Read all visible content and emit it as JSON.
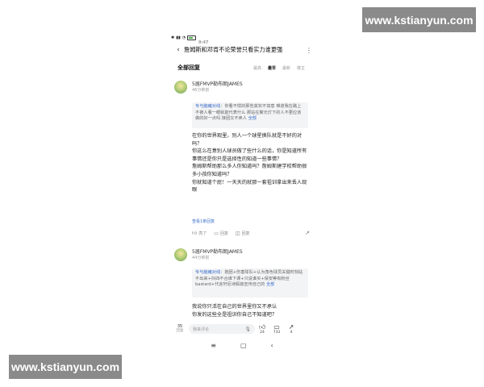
{
  "watermarks": {
    "top": "www.kstianyun.com",
    "bottom": "www.kstianyun.com"
  },
  "status_bar": {
    "time": "9:47",
    "battery_level": 0.6
  },
  "header": {
    "title": "詹姆斯和邓肯不论荣誉只看实力谁更强"
  },
  "replies_section": {
    "title": "全部回复",
    "sort_tabs": [
      "最高",
      "最早",
      "最新",
      "楼主"
    ],
    "active_sort": "最早"
  },
  "comments": [
    {
      "author": "5届FMVP勒布朗JAMES",
      "time": "46分钟前",
      "quote_user": "专与脑瘫对线",
      "quote_text": "：你看不惯的那些其实不如意 难道我在路上不被人看一眼就能代表什么 那站在聚光灯下的人不更应该做的好一点吗 接团又不卖人",
      "quote_more": "全部",
      "body": [
        "在你的世界观里，别人一个球星换队就是不好的对吗？",
        "你这么在意别人球员做了些什么的话，你是知道所有事情还是你只是选择性的知道一些事情？",
        "詹姆斯帮助那么多人你知道吗？詹姆斯建学校帮助很多小孩你知道吗？",
        "你就知道个屁！一天天的就那一套祖训拿出来丢人现眼"
      ],
      "view_replies": "查看1条回复",
      "actions": {
        "like": "亮了",
        "reply": "回复",
        "share_reply": "回复"
      }
    },
    {
      "author": "5届FMVP勒布朗JAMES",
      "time": "44分钟前",
      "quote_user": "专与脑瘫对线",
      "quote_text": "：抱团+伤害球队+认为角色球员关键时刻站不出来+抖四不合谁下课+只说谁买+保安等有粉丝bastard+代言轩尼诗假装宣传自己的",
      "quote_more": "全部",
      "body": [
        "我说你只活在自己的世界里你又不承认",
        "你发的这些全是祖训你自己不知道吧？"
      ]
    }
  ],
  "bottom_bar": {
    "page_number": "35",
    "page_label": "回复",
    "comment_placeholder": "我来评论",
    "light_count": "24",
    "comment_count": "733",
    "share_count": "4"
  },
  "icons": {
    "back": "chevron-left-icon",
    "more": "more-vertical-icon",
    "like": "thumbs-up-icon",
    "comment": "comment-icon",
    "share": "share-icon",
    "mic": "mic-icon"
  }
}
